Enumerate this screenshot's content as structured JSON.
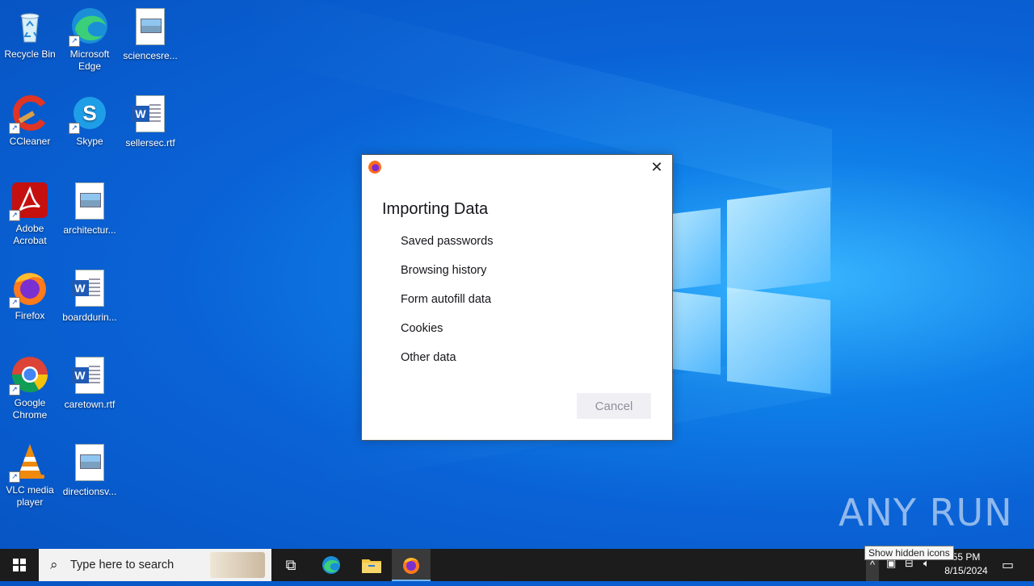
{
  "desktop": {
    "icons": [
      {
        "label": "Recycle Bin"
      },
      {
        "label": "Microsoft Edge"
      },
      {
        "label": "sciencesre..."
      },
      {
        "label": "CCleaner"
      },
      {
        "label": "Skype"
      },
      {
        "label": "sellersec.rtf"
      },
      {
        "label": "Adobe Acrobat"
      },
      {
        "label": "architectur..."
      },
      {
        "label": "Firefox"
      },
      {
        "label": "boarddurin..."
      },
      {
        "label": "Google Chrome"
      },
      {
        "label": "caretown.rtf"
      },
      {
        "label": "VLC media player"
      },
      {
        "label": "directionsv..."
      }
    ]
  },
  "dialog": {
    "title": "Importing Data",
    "items": [
      "Saved passwords",
      "Browsing history",
      "Form autofill data",
      "Cookies",
      "Other data"
    ],
    "cancel_label": "Cancel",
    "close_glyph": "✕"
  },
  "watermark": {
    "text": "ANY RUN"
  },
  "taskbar": {
    "search_placeholder": "Type here to search",
    "clock_time": "55 PM",
    "clock_date": "8/15/2024",
    "tooltip": "Show hidden icons"
  },
  "colors": {
    "accent": "#0a63d6",
    "taskbar": "#1c1c1c"
  }
}
